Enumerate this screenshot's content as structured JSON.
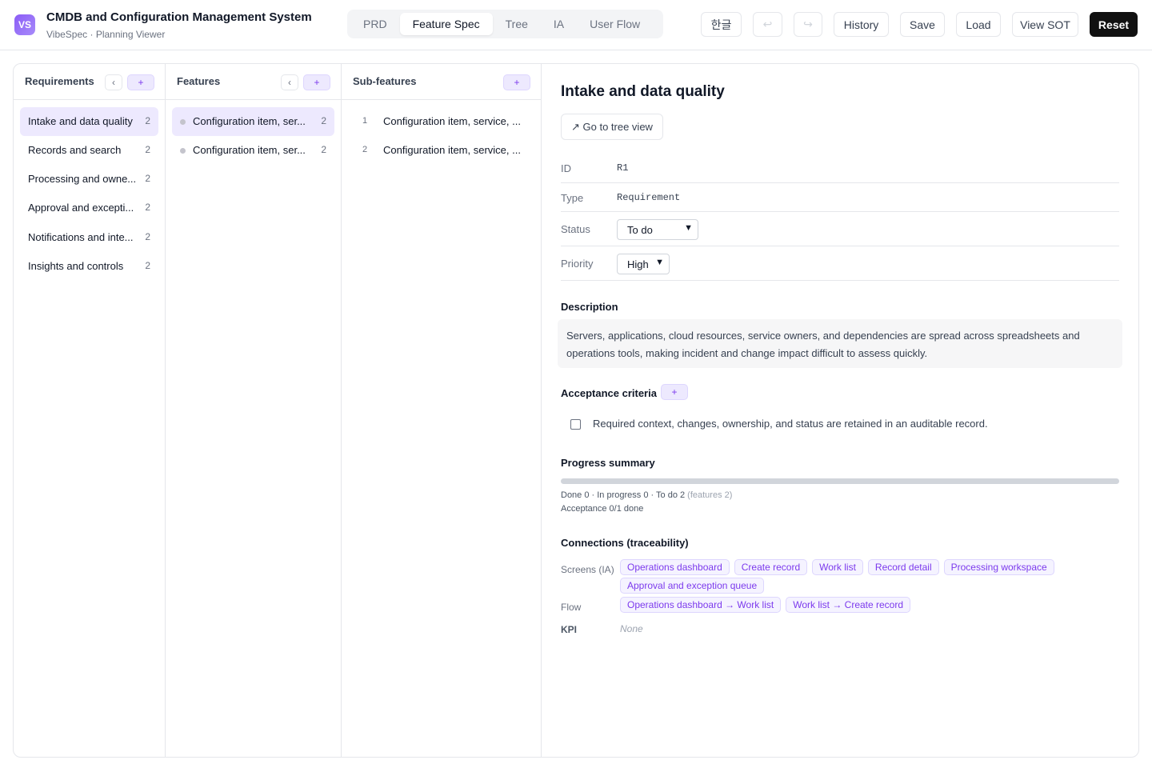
{
  "header": {
    "logo": "VS",
    "title": "CMDB and Configuration Management System",
    "subtitle": "VibeSpec · Planning Viewer",
    "tabs": [
      {
        "label": "PRD",
        "active": false
      },
      {
        "label": "Feature Spec",
        "active": true
      },
      {
        "label": "Tree",
        "active": false
      },
      {
        "label": "IA",
        "active": false
      },
      {
        "label": "User Flow",
        "active": false
      }
    ],
    "lang_label": "한글",
    "undo_icon": "↩",
    "redo_icon": "↪",
    "history_label": "History",
    "save_label": "Save",
    "load_label": "Load",
    "view_sot_label": "View SOT",
    "reset_label": "Reset"
  },
  "requirements": {
    "title": "Requirements",
    "back_icon": "‹",
    "add_icon": "+",
    "items": [
      {
        "label": "Intake and data quality",
        "count": "2",
        "active": true
      },
      {
        "label": "Records and search",
        "count": "2",
        "active": false
      },
      {
        "label": "Processing and owne...",
        "count": "2",
        "active": false
      },
      {
        "label": "Approval and excepti...",
        "count": "2",
        "active": false
      },
      {
        "label": "Notifications and inte...",
        "count": "2",
        "active": false
      },
      {
        "label": "Insights and controls",
        "count": "2",
        "active": false
      }
    ]
  },
  "features": {
    "title": "Features",
    "back_icon": "‹",
    "add_icon": "+",
    "items": [
      {
        "label": "Configuration item, ser...",
        "count": "2",
        "active": true
      },
      {
        "label": "Configuration item, ser...",
        "count": "2",
        "active": false
      }
    ]
  },
  "subfeatures": {
    "title": "Sub-features",
    "add_icon": "+",
    "items": [
      {
        "num": "1",
        "label": "Configuration item, service, ..."
      },
      {
        "num": "2",
        "label": "Configuration item, service, ..."
      }
    ]
  },
  "detail": {
    "title": "Intake and data quality",
    "goto_label": "↗ Go to tree view",
    "id_label": "ID",
    "id_value": "R1",
    "type_label": "Type",
    "type_value": "Requirement",
    "status_label": "Status",
    "status_value": "To do",
    "priority_label": "Priority",
    "priority_value": "High",
    "description_heading": "Description",
    "description": "Servers, applications, cloud resources, service owners, and dependencies are spread across spreadsheets and operations tools, making incident and change impact difficult to assess quickly.",
    "acceptance_heading": "Acceptance criteria",
    "acceptance_add": "+",
    "acceptance_items": [
      {
        "text": "Required context, changes, ownership, and status are retained in an auditable record.",
        "checked": false
      }
    ],
    "progress_heading": "Progress summary",
    "progress_fraction": 0,
    "progress_line1": "Done 0 · In progress 0 · To do 2",
    "progress_line1_muted": "(features 2)",
    "progress_line2": "Acceptance 0/1 done",
    "connections_heading": "Connections (traceability)",
    "screens_label": "Screens (IA)",
    "screens": [
      "Operations dashboard",
      "Create record",
      "Work list",
      "Record detail",
      "Processing workspace",
      "Approval and exception queue"
    ],
    "flow_label": "Flow",
    "flows": [
      "Operations dashboard → Work list",
      "Work list → Create record"
    ],
    "kpi_label": "KPI",
    "kpi_value": "None"
  },
  "colors": {
    "accent": "#7c3aed",
    "accent_bg": "#ede9fe",
    "chip_bg": "#f5f3ff"
  }
}
